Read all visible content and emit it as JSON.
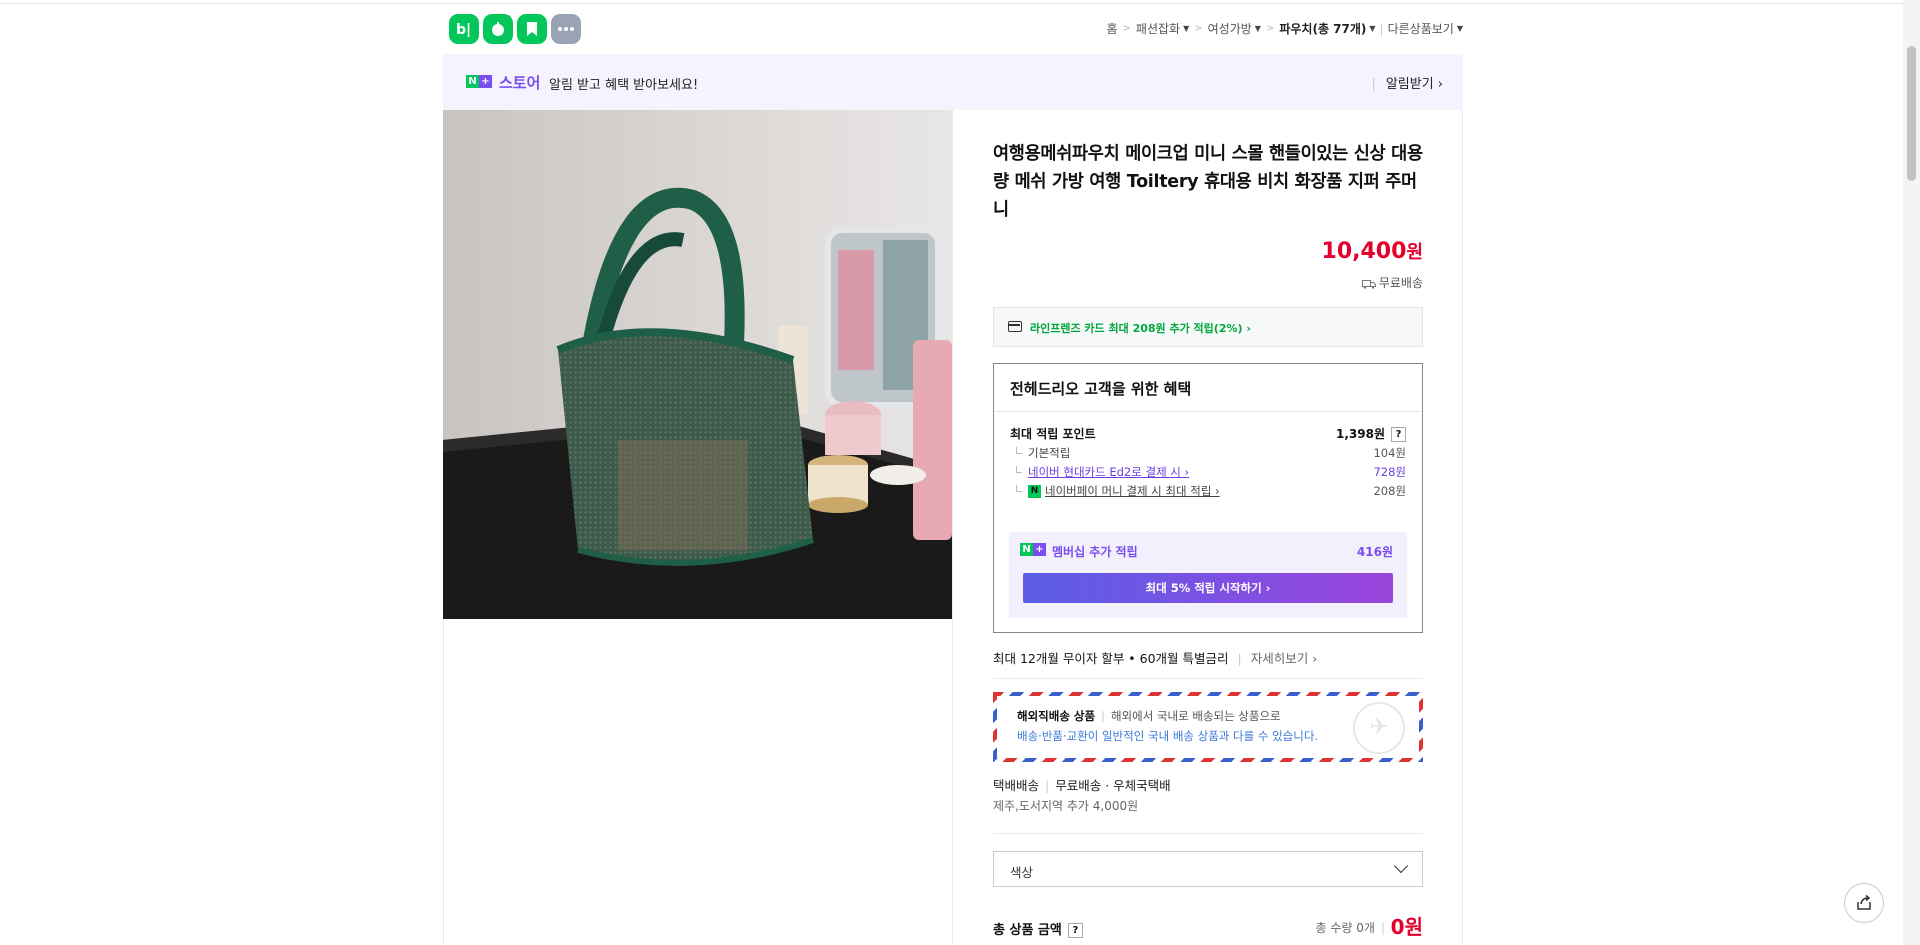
{
  "header": {
    "icons": [
      "blog-icon",
      "band-icon",
      "bookmark-icon",
      "more-icon"
    ],
    "breadcrumb": {
      "home": "홈",
      "cat1": "패션잡화",
      "cat2": "여성가방",
      "current": "파우치(총 77개)",
      "other": "다른상품보기"
    }
  },
  "banner": {
    "store_label": "스토어",
    "message": "알림 받고 혜택 받아보세요!",
    "notify": "알림받기 ›"
  },
  "product": {
    "title": "여행용메쉬파우치 메이크업 미니 스몰 핸들이있는 신상 대용량 메쉬 가방 여행 Toiltery 휴대용 비치 화장품 지퍼 주머니",
    "price": "10,400",
    "currency": "원",
    "shipping": "무료배송",
    "card_benefit": "라인프렌즈 카드 최대 208원 추가 적립(2%) ›"
  },
  "benefit": {
    "heading": "전헤드리오 고객을 위한 혜택",
    "max_points_label": "최대 적립 포인트",
    "max_points_value": "1,398원",
    "help": "?",
    "rows": [
      {
        "label": "기본적립",
        "value": "104원"
      },
      {
        "label": "네이버 현대카드 Ed2로 결제 시 ›",
        "value": "728원"
      },
      {
        "label": "네이버페이 머니 결제 시 최대 적립 ›",
        "value": "208원"
      }
    ],
    "npay_mark": "N",
    "membership_label": "멤버십 추가 적립",
    "membership_value": "416원",
    "membership_button": "최대 5% 적립 시작하기 ›"
  },
  "installment": {
    "text": "최대 12개월 무이자 할부 • 60개월 특별금리",
    "more": "자세히보기 ›"
  },
  "overseas": {
    "title": "해외직배송 상품",
    "desc": "해외에서 국내로 배송되는 상품으로",
    "note": "배송·반품·교환이 일반적인 국내 배송 상품과 다를 수 있습니다."
  },
  "delivery": {
    "method": "택배배송",
    "fee": "무료배송",
    "carrier": "· 우체국택배",
    "extra": "제주,도서지역 추가 4,000원"
  },
  "option": {
    "color_placeholder": "색상"
  },
  "total": {
    "label": "총 상품 금액",
    "help": "?",
    "qty": "총 수량 0개",
    "amount": "0원"
  },
  "colors": {
    "accent_red": "#e4002b",
    "naver_green": "#03c75a",
    "purple": "#7a4df0",
    "banner_bg": "#f4f3fe"
  }
}
